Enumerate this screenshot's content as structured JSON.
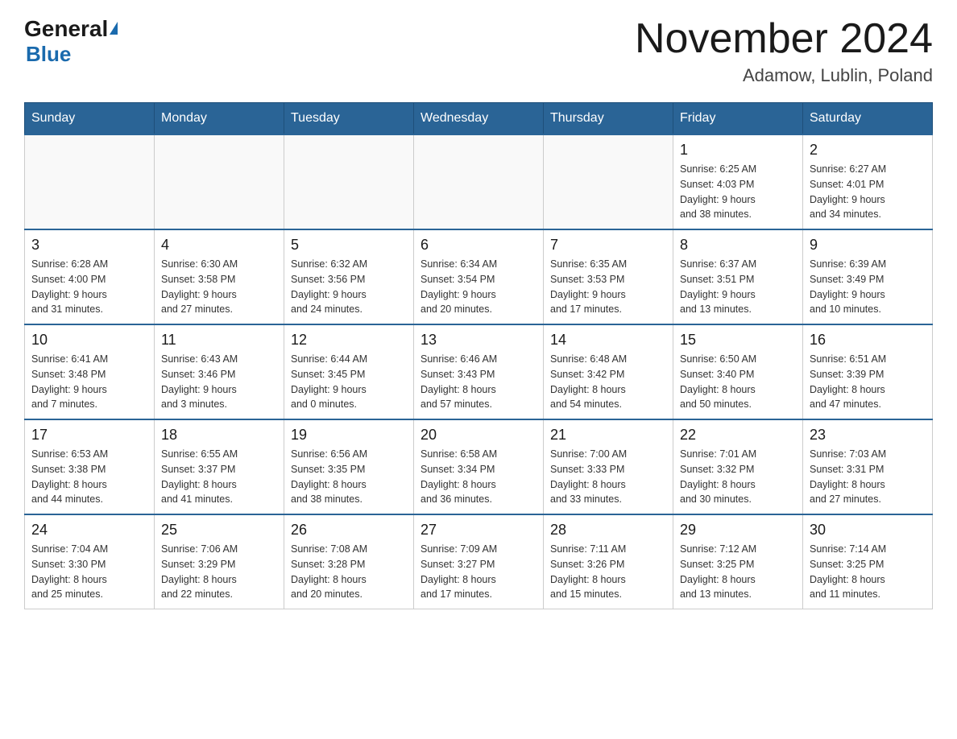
{
  "header": {
    "logo_general": "General",
    "logo_blue": "Blue",
    "month_title": "November 2024",
    "location": "Adamow, Lublin, Poland"
  },
  "days_of_week": [
    "Sunday",
    "Monday",
    "Tuesday",
    "Wednesday",
    "Thursday",
    "Friday",
    "Saturday"
  ],
  "weeks": [
    {
      "days": [
        {
          "date": "",
          "info": ""
        },
        {
          "date": "",
          "info": ""
        },
        {
          "date": "",
          "info": ""
        },
        {
          "date": "",
          "info": ""
        },
        {
          "date": "",
          "info": ""
        },
        {
          "date": "1",
          "info": "Sunrise: 6:25 AM\nSunset: 4:03 PM\nDaylight: 9 hours\nand 38 minutes."
        },
        {
          "date": "2",
          "info": "Sunrise: 6:27 AM\nSunset: 4:01 PM\nDaylight: 9 hours\nand 34 minutes."
        }
      ]
    },
    {
      "days": [
        {
          "date": "3",
          "info": "Sunrise: 6:28 AM\nSunset: 4:00 PM\nDaylight: 9 hours\nand 31 minutes."
        },
        {
          "date": "4",
          "info": "Sunrise: 6:30 AM\nSunset: 3:58 PM\nDaylight: 9 hours\nand 27 minutes."
        },
        {
          "date": "5",
          "info": "Sunrise: 6:32 AM\nSunset: 3:56 PM\nDaylight: 9 hours\nand 24 minutes."
        },
        {
          "date": "6",
          "info": "Sunrise: 6:34 AM\nSunset: 3:54 PM\nDaylight: 9 hours\nand 20 minutes."
        },
        {
          "date": "7",
          "info": "Sunrise: 6:35 AM\nSunset: 3:53 PM\nDaylight: 9 hours\nand 17 minutes."
        },
        {
          "date": "8",
          "info": "Sunrise: 6:37 AM\nSunset: 3:51 PM\nDaylight: 9 hours\nand 13 minutes."
        },
        {
          "date": "9",
          "info": "Sunrise: 6:39 AM\nSunset: 3:49 PM\nDaylight: 9 hours\nand 10 minutes."
        }
      ]
    },
    {
      "days": [
        {
          "date": "10",
          "info": "Sunrise: 6:41 AM\nSunset: 3:48 PM\nDaylight: 9 hours\nand 7 minutes."
        },
        {
          "date": "11",
          "info": "Sunrise: 6:43 AM\nSunset: 3:46 PM\nDaylight: 9 hours\nand 3 minutes."
        },
        {
          "date": "12",
          "info": "Sunrise: 6:44 AM\nSunset: 3:45 PM\nDaylight: 9 hours\nand 0 minutes."
        },
        {
          "date": "13",
          "info": "Sunrise: 6:46 AM\nSunset: 3:43 PM\nDaylight: 8 hours\nand 57 minutes."
        },
        {
          "date": "14",
          "info": "Sunrise: 6:48 AM\nSunset: 3:42 PM\nDaylight: 8 hours\nand 54 minutes."
        },
        {
          "date": "15",
          "info": "Sunrise: 6:50 AM\nSunset: 3:40 PM\nDaylight: 8 hours\nand 50 minutes."
        },
        {
          "date": "16",
          "info": "Sunrise: 6:51 AM\nSunset: 3:39 PM\nDaylight: 8 hours\nand 47 minutes."
        }
      ]
    },
    {
      "days": [
        {
          "date": "17",
          "info": "Sunrise: 6:53 AM\nSunset: 3:38 PM\nDaylight: 8 hours\nand 44 minutes."
        },
        {
          "date": "18",
          "info": "Sunrise: 6:55 AM\nSunset: 3:37 PM\nDaylight: 8 hours\nand 41 minutes."
        },
        {
          "date": "19",
          "info": "Sunrise: 6:56 AM\nSunset: 3:35 PM\nDaylight: 8 hours\nand 38 minutes."
        },
        {
          "date": "20",
          "info": "Sunrise: 6:58 AM\nSunset: 3:34 PM\nDaylight: 8 hours\nand 36 minutes."
        },
        {
          "date": "21",
          "info": "Sunrise: 7:00 AM\nSunset: 3:33 PM\nDaylight: 8 hours\nand 33 minutes."
        },
        {
          "date": "22",
          "info": "Sunrise: 7:01 AM\nSunset: 3:32 PM\nDaylight: 8 hours\nand 30 minutes."
        },
        {
          "date": "23",
          "info": "Sunrise: 7:03 AM\nSunset: 3:31 PM\nDaylight: 8 hours\nand 27 minutes."
        }
      ]
    },
    {
      "days": [
        {
          "date": "24",
          "info": "Sunrise: 7:04 AM\nSunset: 3:30 PM\nDaylight: 8 hours\nand 25 minutes."
        },
        {
          "date": "25",
          "info": "Sunrise: 7:06 AM\nSunset: 3:29 PM\nDaylight: 8 hours\nand 22 minutes."
        },
        {
          "date": "26",
          "info": "Sunrise: 7:08 AM\nSunset: 3:28 PM\nDaylight: 8 hours\nand 20 minutes."
        },
        {
          "date": "27",
          "info": "Sunrise: 7:09 AM\nSunset: 3:27 PM\nDaylight: 8 hours\nand 17 minutes."
        },
        {
          "date": "28",
          "info": "Sunrise: 7:11 AM\nSunset: 3:26 PM\nDaylight: 8 hours\nand 15 minutes."
        },
        {
          "date": "29",
          "info": "Sunrise: 7:12 AM\nSunset: 3:25 PM\nDaylight: 8 hours\nand 13 minutes."
        },
        {
          "date": "30",
          "info": "Sunrise: 7:14 AM\nSunset: 3:25 PM\nDaylight: 8 hours\nand 11 minutes."
        }
      ]
    }
  ]
}
